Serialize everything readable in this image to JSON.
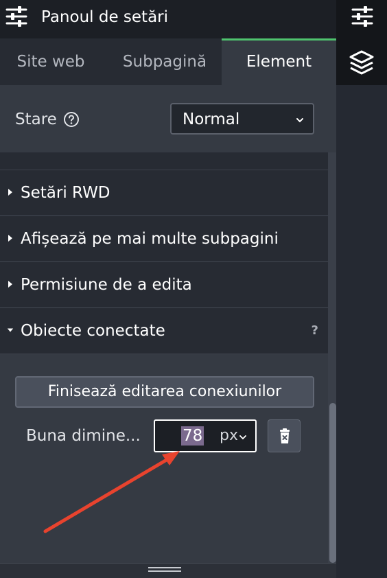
{
  "header": {
    "title": "Panoul de setări",
    "icon": "sliders-icon"
  },
  "tabs": [
    {
      "label": "Site web",
      "active": false
    },
    {
      "label": "Subpagină",
      "active": false
    },
    {
      "label": "Element",
      "active": true
    }
  ],
  "state": {
    "label": "Stare",
    "help_icon": "question-circle-icon",
    "selected": "Normal"
  },
  "sections": [
    {
      "label": "Setări RWD",
      "expanded": false
    },
    {
      "label": "Afișează pe mai multe subpagini",
      "expanded": false
    },
    {
      "label": "Permisiune de a edita",
      "expanded": false
    },
    {
      "label": "Obiecte conectate",
      "expanded": true,
      "help": "?"
    }
  ],
  "connected": {
    "finish_button": "Finisează editarea conexiunilor",
    "item_label": "Buna dimine...",
    "value": "78",
    "unit": "px",
    "delete_icon": "trash-icon"
  },
  "sidebar": {
    "icons": [
      "sliders-icon",
      "layers-icon"
    ]
  },
  "colors": {
    "accent": "#4fc46e",
    "panel_bg": "#2f333c",
    "header_bg": "#1c1f25",
    "annotation_arrow": "#e8432e"
  }
}
